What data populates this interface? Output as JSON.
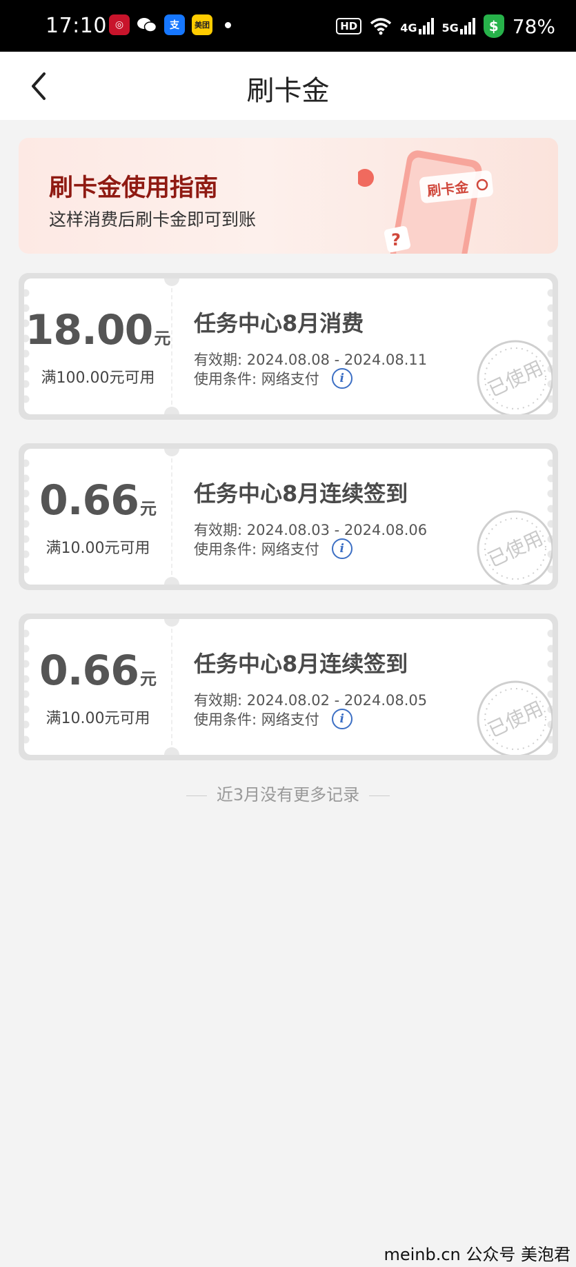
{
  "status_bar": {
    "time": "17:10",
    "battery": "78%",
    "hd": "HD",
    "net1": "4G",
    "net2": "5G",
    "icons": [
      "bank-app-icon",
      "wechat-icon",
      "alipay-icon",
      "meituan-icon",
      "wifi-icon",
      "signal-icon",
      "security-shield-icon"
    ],
    "meituan_label": "美团",
    "alipay_label": "支"
  },
  "nav": {
    "title": "刷卡金"
  },
  "banner": {
    "title": "刷卡金使用指南",
    "subtitle": "这样消费后刷卡金即可到账",
    "art_label": "刷卡金"
  },
  "coupons": [
    {
      "amount": "18.00",
      "unit": "元",
      "condition": "满100.00元可用",
      "title": "任务中心8月消费",
      "validity": "有效期: 2024.08.08 - 2024.08.11",
      "usage": "使用条件:  网络支付",
      "stamp": "已使用"
    },
    {
      "amount": "0.66",
      "unit": "元",
      "condition": "满10.00元可用",
      "title": "任务中心8月连续签到",
      "validity": "有效期: 2024.08.03 - 2024.08.06",
      "usage": "使用条件:  网络支付",
      "stamp": "已使用"
    },
    {
      "amount": "0.66",
      "unit": "元",
      "condition": "满10.00元可用",
      "title": "任务中心8月连续签到",
      "validity": "有效期: 2024.08.02 - 2024.08.05",
      "usage": "使用条件:  网络支付",
      "stamp": "已使用"
    }
  ],
  "footer": {
    "no_more": "近3月没有更多记录"
  },
  "watermark": "meinb.cn  公众号 美泡君",
  "colors": {
    "banner_title": "#8f1a12",
    "info": "#3c6fc4",
    "status_green": "#27b24a"
  }
}
